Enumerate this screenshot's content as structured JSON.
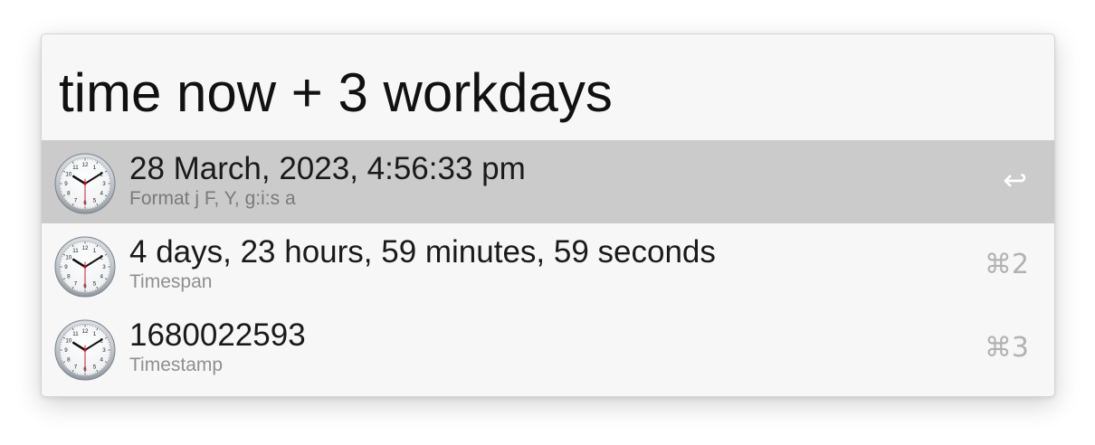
{
  "search": {
    "query": "time now + 3 workdays"
  },
  "results": [
    {
      "icon": "clock-icon",
      "title": "28 March, 2023, 4:56:33 pm",
      "subtitle": "Format j F, Y, g:i:s a",
      "shortcut": "↩",
      "selected": true
    },
    {
      "icon": "clock-icon",
      "title": "4 days, 23 hours, 59 minutes, 59 seconds",
      "subtitle": "Timespan",
      "shortcut": "⌘2",
      "selected": false
    },
    {
      "icon": "clock-icon",
      "title": "1680022593",
      "subtitle": "Timestamp",
      "shortcut": "⌘3",
      "selected": false
    }
  ],
  "colors": {
    "selected_row": "#cbcbcb",
    "background": "#f7f7f7",
    "second_hand": "#d0021b"
  }
}
